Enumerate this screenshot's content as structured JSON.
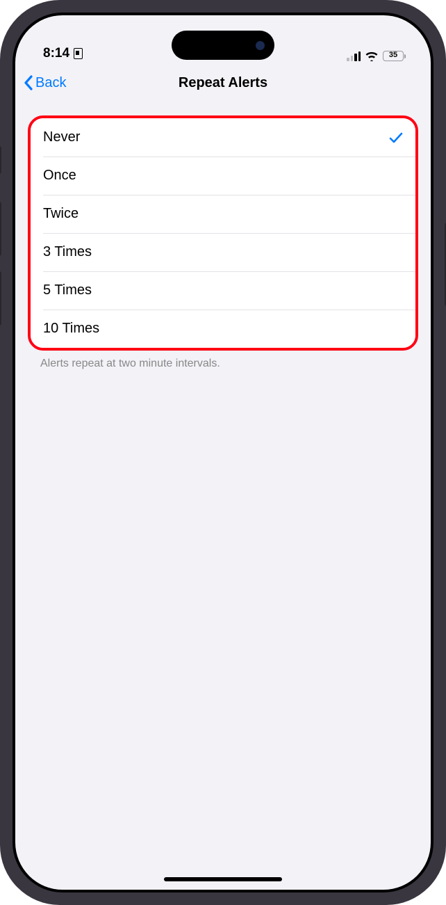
{
  "status": {
    "time": "8:14",
    "battery_level": "35",
    "battery_percent": 35
  },
  "nav": {
    "back_label": "Back",
    "title": "Repeat Alerts"
  },
  "options": [
    {
      "label": "Never",
      "selected": true
    },
    {
      "label": "Once",
      "selected": false
    },
    {
      "label": "Twice",
      "selected": false
    },
    {
      "label": "3 Times",
      "selected": false
    },
    {
      "label": "5 Times",
      "selected": false
    },
    {
      "label": "10 Times",
      "selected": false
    }
  ],
  "footer": "Alerts repeat at two minute intervals."
}
